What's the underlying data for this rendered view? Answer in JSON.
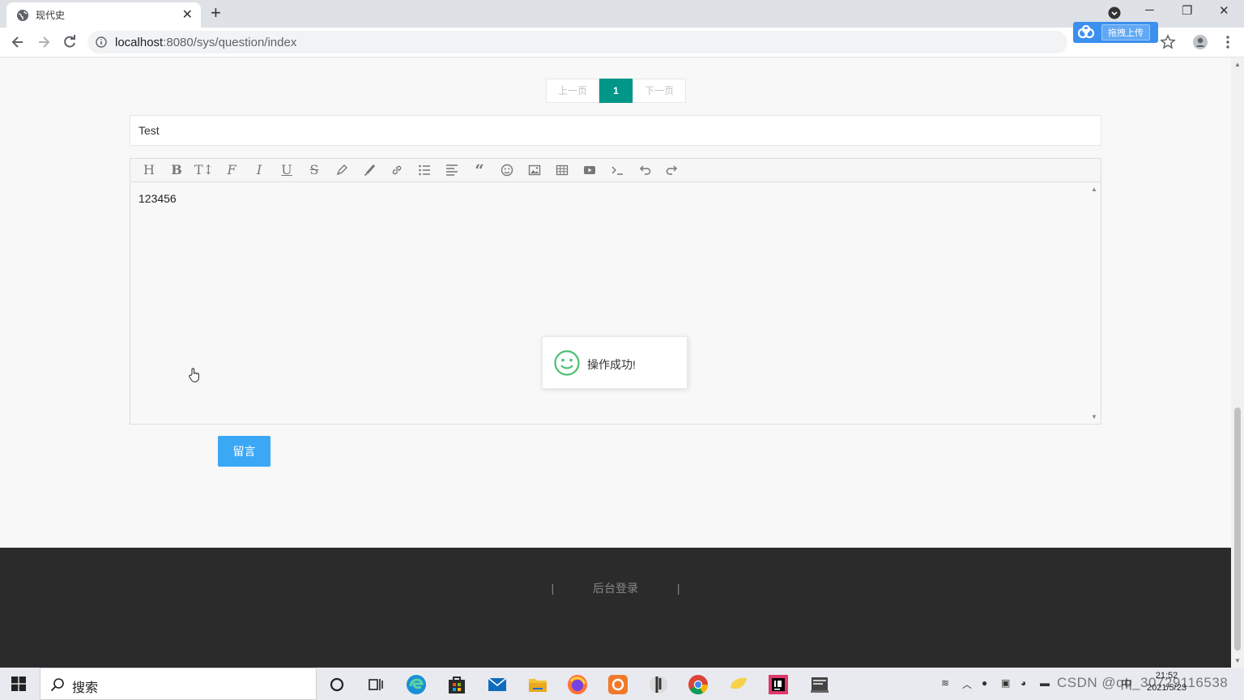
{
  "browser": {
    "tab_title": "现代史",
    "tab_close": "✕",
    "new_tab": "+",
    "url_host": "localhost",
    "url_path": ":8080/sys/question/index",
    "extension_label": "拖拽上传",
    "window_controls": {
      "minimize": "─",
      "restore": "❐",
      "close": "✕"
    }
  },
  "pagination": {
    "prev": "上一页",
    "current": "1",
    "next": "下一页"
  },
  "question": {
    "title_value": "Test"
  },
  "editor": {
    "toolbar_icons": [
      "heading-icon",
      "bold-icon",
      "font-size-icon",
      "font-family-icon",
      "italic-icon",
      "underline-icon",
      "strikethrough-icon",
      "fore-color-icon",
      "background-color-icon",
      "link-icon",
      "list-icon",
      "justify-icon",
      "quote-icon",
      "emoticon-icon",
      "image-icon",
      "table-icon",
      "video-icon",
      "code-icon",
      "undo-icon",
      "redo-icon"
    ],
    "content": "123456"
  },
  "toast": {
    "message": "操作成功!"
  },
  "submit_button": "留言",
  "footer": {
    "sep1": "|",
    "admin_login": "后台登录",
    "sep2": "|"
  },
  "taskbar": {
    "search_placeholder": "搜索",
    "time": "21:52",
    "date": "2021/5/23",
    "ime": "中",
    "watermark": "CSDN @qq_30729116538"
  },
  "colors": {
    "accent_teal": "#009688",
    "button_blue": "#3aa8f5",
    "footer_bg": "#2b2b2b",
    "toast_icon": "#4bbf73"
  }
}
